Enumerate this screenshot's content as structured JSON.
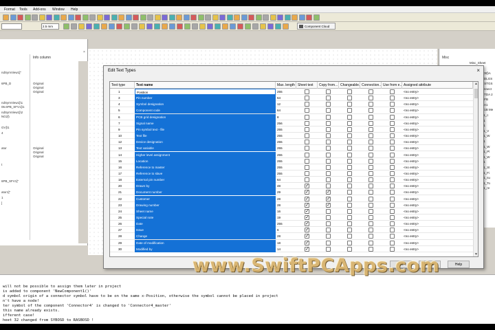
{
  "menu": [
    "Format",
    "Tools",
    "Add-ons",
    "Window",
    "Help"
  ],
  "toolbar": {
    "zoom_value": "2.5 mm",
    "component_cloud_label": "Component Cloud"
  },
  "left_panel": {
    "column_header": "Info column",
    "rows": [
      {
        "a": "ndSymView1]\"",
        "b": ""
      },
      {
        "a": "6PB_D",
        "b": "Original"
      },
      {
        "a": "",
        "b": "Original"
      },
      {
        "a": "",
        "b": "Original"
      },
      {
        "a": "ndSymView1]\\1",
        "b": ""
      },
      {
        "a": "06.6PB_SFV1]\\1",
        "b": ""
      },
      {
        "a": "ndSymView1]\\2",
        "b": ""
      },
      {
        "a": "NG2]\\",
        "b": ""
      },
      {
        "a": "GV]\\1",
        "b": ""
      },
      {
        "a": "4",
        "b": ""
      },
      {
        "a": "ator",
        "b": "Original"
      },
      {
        "a": "",
        "b": "Original"
      },
      {
        "a": "",
        "b": "Original"
      },
      {
        "a": "t",
        "b": ""
      },
      {
        "a": "6PB_SFV1]\"",
        "b": ""
      },
      {
        "a": "ator1]\"",
        "b": ""
      },
      {
        "a": "1",
        "b": ""
      },
      {
        "a": "]",
        "b": ""
      }
    ]
  },
  "right_panel": {
    "title": "Misc",
    "items": [
      "Misc_Sheet",
      "Graphic",
      "[0400]\\A",
      "[ReDLGS",
      "SE STGS",
      "[Connect",
      "SE TDA 2",
      "ES FB",
      "ES A1",
      "ES 1B Me",
      "NA1_c",
      "NA1",
      "NA1",
      "NA1_V",
      "NA1_W",
      "NA1",
      "NA1_W",
      "NA1_Pl",
      "NA1_W",
      "NA1",
      "NA1_St",
      "NA1_Fi",
      "NA1_su",
      "NA1_To",
      "NA1_re"
    ]
  },
  "dialog": {
    "title": "Edit Text Types",
    "columns": [
      "Text type",
      "Text name",
      "Max. length",
      "Sheet text",
      "Copy from...",
      "Changeable...",
      "Connection...",
      "Use from e...",
      "Assigned attribute"
    ],
    "rows": [
      {
        "type": "1",
        "name": "Position",
        "max": "255",
        "sheet": false,
        "copy": false,
        "chg": false,
        "conn": false,
        "use": false,
        "attr": "<no entry>"
      },
      {
        "type": "3",
        "name": "Pin number",
        "max": "64",
        "sheet": false,
        "copy": false,
        "chg": false,
        "conn": false,
        "use": false,
        "attr": "<no entry>"
      },
      {
        "type": "4",
        "name": "Symbol designation",
        "max": "12",
        "sheet": false,
        "copy": false,
        "chg": false,
        "conn": false,
        "use": false,
        "attr": "<no entry>"
      },
      {
        "type": "5",
        "name": "Component code",
        "max": "64",
        "sheet": false,
        "copy": false,
        "chg": false,
        "conn": false,
        "use": false,
        "attr": "<no entry>"
      },
      {
        "type": "6",
        "name": "PCB grid designation",
        "max": "8",
        "sheet": false,
        "copy": false,
        "chg": false,
        "conn": false,
        "use": false,
        "attr": "<no entry>"
      },
      {
        "type": "7",
        "name": "Signal name",
        "max": "256",
        "sheet": false,
        "copy": false,
        "chg": false,
        "conn": false,
        "use": false,
        "attr": "<no entry>"
      },
      {
        "type": "9",
        "name": "Pin symbol text - file",
        "max": "255",
        "sheet": false,
        "copy": false,
        "chg": false,
        "conn": false,
        "use": false,
        "attr": "<no entry>"
      },
      {
        "type": "10",
        "name": "Text file",
        "max": "255",
        "sheet": false,
        "copy": false,
        "chg": false,
        "conn": false,
        "use": false,
        "attr": "<no entry>"
      },
      {
        "type": "12",
        "name": "Device designation",
        "max": "255",
        "sheet": false,
        "copy": false,
        "chg": false,
        "conn": false,
        "use": false,
        "attr": "<no entry>"
      },
      {
        "type": "13",
        "name": "Text variable",
        "max": "255",
        "sheet": false,
        "copy": false,
        "chg": false,
        "conn": false,
        "use": false,
        "attr": "<no entry>"
      },
      {
        "type": "14",
        "name": "Higher level assignment",
        "max": "255",
        "sheet": false,
        "copy": false,
        "chg": false,
        "conn": false,
        "use": false,
        "attr": "<no entry>"
      },
      {
        "type": "15",
        "name": "Location",
        "max": "255",
        "sheet": false,
        "copy": false,
        "chg": false,
        "conn": false,
        "use": false,
        "attr": "<no entry>"
      },
      {
        "type": "16",
        "name": "Reference to master",
        "max": "255",
        "sheet": false,
        "copy": false,
        "chg": false,
        "conn": false,
        "use": false,
        "attr": "<no entry>"
      },
      {
        "type": "17",
        "name": "Reference to slave",
        "max": "255",
        "sheet": false,
        "copy": false,
        "chg": false,
        "conn": false,
        "use": false,
        "attr": "<no entry>"
      },
      {
        "type": "18",
        "name": "External pin number",
        "max": "64",
        "sheet": false,
        "copy": false,
        "chg": false,
        "conn": false,
        "use": false,
        "attr": "<no entry>"
      },
      {
        "type": "20",
        "name": "Drawn by",
        "max": "48",
        "sheet": true,
        "copy": false,
        "chg": false,
        "conn": false,
        "use": false,
        "attr": "<no entry>"
      },
      {
        "type": "21",
        "name": "Document number",
        "max": "29",
        "sheet": true,
        "copy": true,
        "chg": false,
        "conn": false,
        "use": false,
        "attr": "<no entry>"
      },
      {
        "type": "22",
        "name": "Customer",
        "max": "28",
        "sheet": true,
        "copy": true,
        "chg": false,
        "conn": false,
        "use": false,
        "attr": "<no entry>"
      },
      {
        "type": "23",
        "name": "Drawing number",
        "max": "28",
        "sheet": true,
        "copy": true,
        "chg": false,
        "conn": false,
        "use": false,
        "attr": "<no entry>"
      },
      {
        "type": "24",
        "name": "Sheet name",
        "max": "16",
        "sheet": true,
        "copy": false,
        "chg": false,
        "conn": false,
        "use": false,
        "attr": "<no entry>"
      },
      {
        "type": "25",
        "name": "Special note",
        "max": "19",
        "sheet": true,
        "copy": false,
        "chg": false,
        "conn": false,
        "use": false,
        "attr": "<no entry>"
      },
      {
        "type": "26",
        "name": "Date",
        "max": "255",
        "sheet": true,
        "copy": false,
        "chg": false,
        "conn": false,
        "use": false,
        "attr": "<no entry>"
      },
      {
        "type": "27",
        "name": "Issue",
        "max": "6",
        "sheet": true,
        "copy": false,
        "chg": false,
        "conn": false,
        "use": false,
        "attr": "<no entry>"
      },
      {
        "type": "28",
        "name": "Change",
        "max": "28",
        "sheet": true,
        "copy": false,
        "chg": false,
        "conn": false,
        "use": false,
        "attr": "<no entry>"
      },
      {
        "type": "29",
        "name": "Date of modification",
        "max": "18",
        "sheet": true,
        "copy": false,
        "chg": false,
        "conn": false,
        "use": false,
        "attr": "<no entry>"
      },
      {
        "type": "30",
        "name": "Modified by",
        "max": "14",
        "sheet": true,
        "copy": false,
        "chg": false,
        "conn": false,
        "use": false,
        "attr": "<no entry>"
      }
    ],
    "buttons": {
      "ok": "OK",
      "cancel": "Cancel",
      "help": "Help"
    }
  },
  "console_lines": [
    "will not be possible to assign them later in project",
    "is added to component 'NewComponent1()'",
    "d symbol origin of a connector symbol have to be on the same x-Position, otherwise the symbol cannot be placed in project",
    "n't have a node!",
    "ter symbol of the component 'Connector4' is changed to 'Connector4_master'",
    "this name already exists.",
    "ifferent case!",
    "heet 32 changed from SYBOSD to RASBOSD !"
  ],
  "watermark": "www.SwiftPCApps.com",
  "colors": {
    "selection": "#1471d6",
    "watermark": "#d8b26a"
  }
}
